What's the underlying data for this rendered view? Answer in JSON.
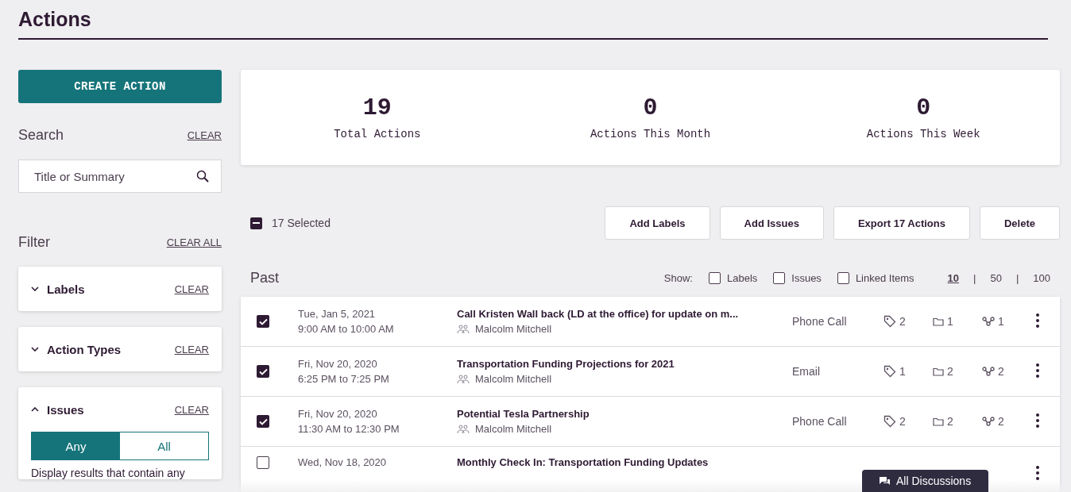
{
  "page_title": "Actions",
  "create_button": "CREATE ACTION",
  "search": {
    "heading": "Search",
    "clear": "CLEAR",
    "placeholder": "Title or Summary"
  },
  "filter": {
    "heading": "Filter",
    "clear_all": "CLEAR ALL",
    "sections": [
      {
        "title": "Labels",
        "clear": "CLEAR",
        "expanded": false
      },
      {
        "title": "Action Types",
        "clear": "CLEAR",
        "expanded": false
      },
      {
        "title": "Issues",
        "clear": "CLEAR",
        "expanded": true,
        "match": [
          {
            "label": "Any",
            "selected": true
          },
          {
            "label": "All",
            "selected": false
          }
        ],
        "description": "Display results that contain any"
      }
    ]
  },
  "stats": [
    {
      "value": "19",
      "label": "Total Actions"
    },
    {
      "value": "0",
      "label": "Actions This Month"
    },
    {
      "value": "0",
      "label": "Actions This Week"
    }
  ],
  "selection": {
    "label": "17 Selected",
    "partial": true
  },
  "bulk_buttons": [
    "Add Labels",
    "Add Issues",
    "Export 17 Actions",
    "Delete"
  ],
  "section_title": "Past",
  "show": {
    "label": "Show:",
    "options": [
      {
        "label": "Labels",
        "checked": false
      },
      {
        "label": "Issues",
        "checked": false
      },
      {
        "label": "Linked Items",
        "checked": false
      }
    ]
  },
  "page_size_separator": "|",
  "page_sizes": [
    {
      "label": "10",
      "selected": true
    },
    {
      "label": "50",
      "selected": false
    },
    {
      "label": "100",
      "selected": false
    }
  ],
  "rows": [
    {
      "checked": true,
      "date": "Tue, Jan 5, 2021",
      "time": "9:00 AM to 10:00 AM",
      "title": "Call Kristen Wall back (LD at the office) for update on m...",
      "owner": "Malcolm Mitchell",
      "type": "Phone Call",
      "labels": "2",
      "issues": "1",
      "links": "1"
    },
    {
      "checked": true,
      "date": "Fri, Nov 20, 2020",
      "time": "6:25 PM to 7:25 PM",
      "title": "Transportation Funding Projections for 2021",
      "owner": "Malcolm Mitchell",
      "type": "Email",
      "labels": "1",
      "issues": "2",
      "links": "2"
    },
    {
      "checked": true,
      "date": "Fri, Nov 20, 2020",
      "time": "11:30 AM to 12:30 PM",
      "title": "Potential Tesla Partnership",
      "owner": "Malcolm Mitchell",
      "type": "Phone Call",
      "labels": "2",
      "issues": "2",
      "links": "2"
    },
    {
      "checked": false,
      "date": "Wed, Nov 18, 2020",
      "title": "Monthly Check In: Transportation Funding Updates"
    }
  ],
  "discussions_button": "All Discussions"
}
